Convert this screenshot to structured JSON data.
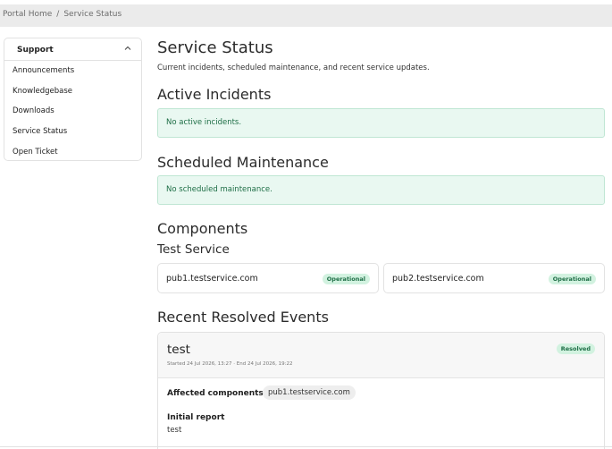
{
  "breadcrumb": {
    "home": "Portal Home",
    "separator": "/",
    "current": "Service Status"
  },
  "sidebar": {
    "title": "Support",
    "toggle_icon": "chevron-up-icon",
    "items": [
      {
        "label": "Announcements"
      },
      {
        "label": "Knowledgebase"
      },
      {
        "label": "Downloads"
      },
      {
        "label": "Service Status"
      },
      {
        "label": "Open Ticket"
      }
    ]
  },
  "page": {
    "title": "Service Status",
    "subtitle": "Current incidents, scheduled maintenance, and recent service updates."
  },
  "active_incidents": {
    "heading": "Active Incidents",
    "message": "No active incidents."
  },
  "maintenance": {
    "heading": "Scheduled Maintenance",
    "message": "No scheduled maintenance."
  },
  "components": {
    "heading": "Components",
    "group": "Test Service",
    "items": [
      {
        "name": "pub1.testservice.com",
        "status": "Operational"
      },
      {
        "name": "pub2.testservice.com",
        "status": "Operational"
      }
    ]
  },
  "resolved": {
    "heading": "Recent Resolved Events",
    "events": [
      {
        "title": "test",
        "status": "Resolved",
        "time": "Started 24 Jul 2026, 13:27 · End 24 Jul 2026, 19:22",
        "affected_label": "Affected components:",
        "affected": "pub1.testservice.com",
        "report_label": "Initial report",
        "report_text": "test"
      }
    ]
  },
  "colors": {
    "success_bg": "#e9f8f1",
    "success_border": "#bfe6d3",
    "success_text": "#1e6e46",
    "badge_bg": "#d2f2e0"
  }
}
